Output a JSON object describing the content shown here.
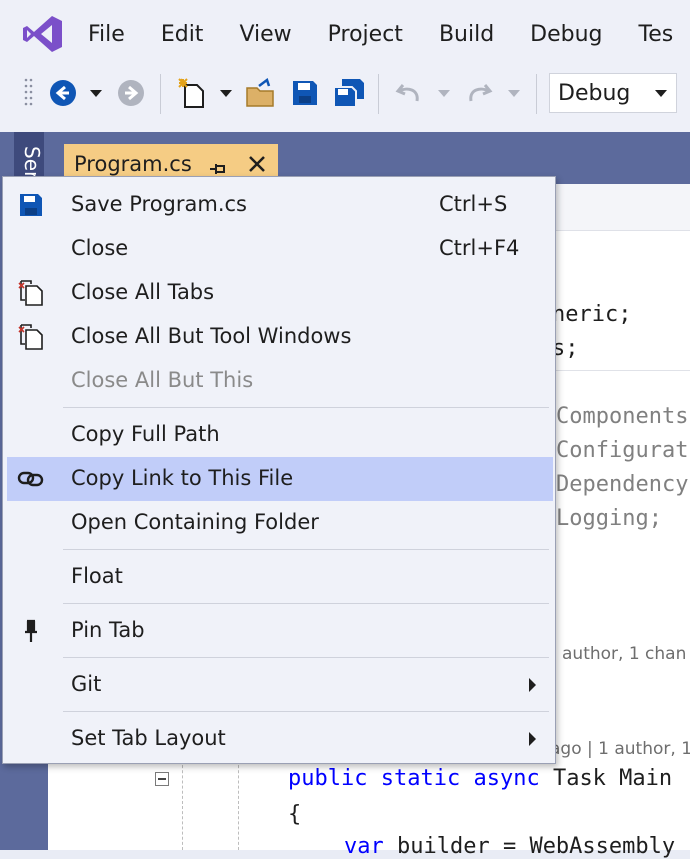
{
  "menubar": {
    "items": [
      "File",
      "Edit",
      "View",
      "Project",
      "Build",
      "Debug",
      "Tes"
    ]
  },
  "toolbar": {
    "configuration": "Debug",
    "icons": [
      "back-icon",
      "back-dropdown-icon",
      "forward-icon",
      "new-project-icon",
      "new-dropdown-icon",
      "open-folder-icon",
      "save-icon",
      "save-all-icon",
      "undo-icon",
      "undo-dropdown-icon",
      "redo-icon",
      "redo-dropdown-icon"
    ]
  },
  "side_panel": {
    "label": "Ser"
  },
  "document_tab": {
    "title": "Program.cs"
  },
  "editor": {
    "lines": [
      "neric;",
      "s;",
      "Components",
      "Configurat",
      "Dependency",
      "Logging;"
    ],
    "codelens_1": "author, 1 chan",
    "codelens_2": "ago | 1 author, 1",
    "method_line": {
      "kw1": "public",
      "kw2": "static",
      "kw3": "async",
      "rest": " Task Main"
    },
    "brace": "{",
    "last_line": {
      "kw": "var",
      "rest": " builder = WebAssembly"
    }
  },
  "context_menu": {
    "save": {
      "label": "Save Program.cs",
      "shortcut": "Ctrl+S"
    },
    "close": {
      "label": "Close",
      "shortcut": "Ctrl+F4"
    },
    "close_all_tabs": {
      "label": "Close All Tabs"
    },
    "close_all_but_tool": {
      "label": "Close All But Tool Windows"
    },
    "close_all_but_this": {
      "label": "Close All But This",
      "disabled": true
    },
    "copy_full_path": {
      "label": "Copy Full Path"
    },
    "copy_link": {
      "label": "Copy Link to This File",
      "highlighted": true
    },
    "open_folder": {
      "label": "Open Containing Folder"
    },
    "float": {
      "label": "Float"
    },
    "pin_tab": {
      "label": "Pin Tab"
    },
    "git": {
      "label": "Git"
    },
    "set_tab_layout": {
      "label": "Set Tab Layout"
    }
  },
  "colors": {
    "accent_purple": "#7b4fc9",
    "menu_highlight": "#c1cdf9",
    "tab_active": "#f5cc84",
    "frame": "#5c6a9c",
    "keyword": "#0000ff",
    "icon_blue": "#0f56b5"
  }
}
